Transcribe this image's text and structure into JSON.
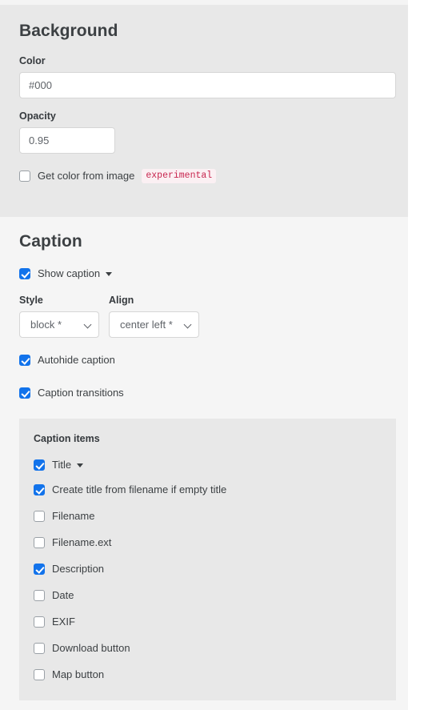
{
  "background": {
    "heading": "Background",
    "color": {
      "label": "Color",
      "value": "#000",
      "placeholder": "#000"
    },
    "opacity": {
      "label": "Opacity",
      "value": "0.95",
      "placeholder": "0.95"
    },
    "get_color_from_image": {
      "label": "Get color from image",
      "checked": false,
      "badge": "experimental"
    }
  },
  "caption": {
    "heading": "Caption",
    "show_caption": {
      "label": "Show caption",
      "checked": true,
      "has_caret": true
    },
    "style": {
      "label": "Style",
      "value": "block *"
    },
    "align": {
      "label": "Align",
      "value": "center left *"
    },
    "autohide_caption": {
      "label": "Autohide caption",
      "checked": true
    },
    "caption_transitions": {
      "label": "Caption transitions",
      "checked": true
    },
    "caption_items": {
      "title": "Caption items",
      "items": [
        {
          "label": "Title",
          "checked": true,
          "has_caret": true
        },
        {
          "label": "Create title from filename if empty title",
          "checked": true,
          "has_caret": false
        },
        {
          "label": "Filename",
          "checked": false,
          "has_caret": false
        },
        {
          "label": "Filename.ext",
          "checked": false,
          "has_caret": false
        },
        {
          "label": "Description",
          "checked": true,
          "has_caret": false
        },
        {
          "label": "Date",
          "checked": false,
          "has_caret": false
        },
        {
          "label": "EXIF",
          "checked": false,
          "has_caret": false
        },
        {
          "label": "Download button",
          "checked": false,
          "has_caret": false
        },
        {
          "label": "Map button",
          "checked": false,
          "has_caret": false
        }
      ]
    }
  },
  "colors": {
    "accent": "#1273eb",
    "panel_dark": "#e8e8e8",
    "panel_light": "#f5f5f5",
    "badge_text": "#c7254e",
    "badge_bg": "#fbf0f3"
  }
}
